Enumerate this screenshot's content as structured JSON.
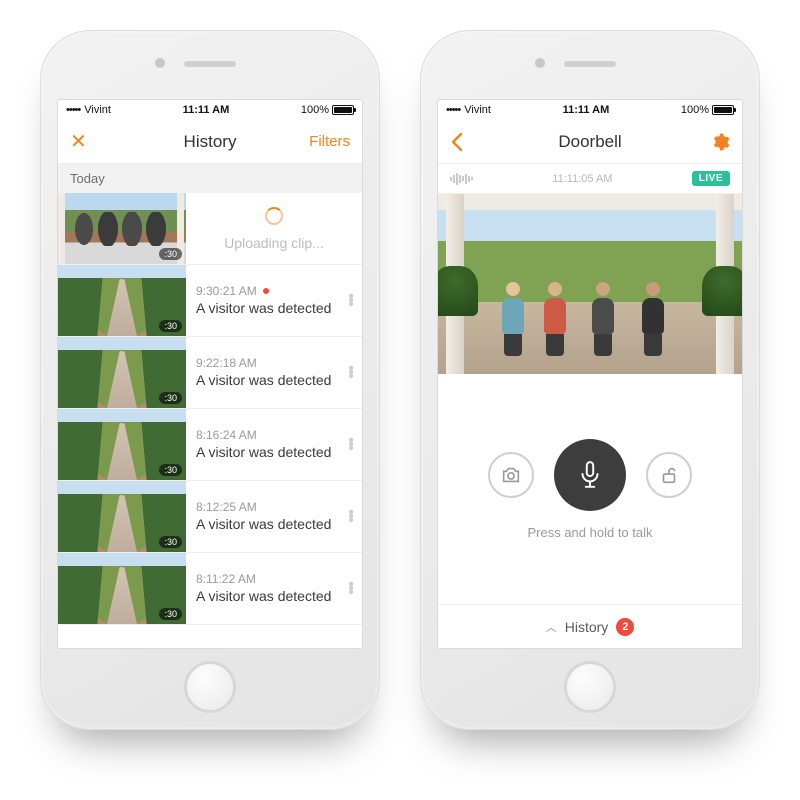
{
  "status": {
    "dots": "•••••",
    "carrier": "Vivint",
    "time": "11:11 AM",
    "battery": "100%"
  },
  "accent": "#f58220",
  "left": {
    "title": "History",
    "filters": "Filters",
    "section": "Today",
    "uploading": "Uploading clip...",
    "clip_duration": ":30",
    "clips": [
      {
        "time": "9:30:21 AM",
        "title": "A visitor was detected",
        "recording": true
      },
      {
        "time": "9:22:18 AM",
        "title": "A visitor was detected",
        "recording": false
      },
      {
        "time": "8:16:24 AM",
        "title": "A visitor was detected",
        "recording": false
      },
      {
        "time": "8:12:25 AM",
        "title": "A visitor was detected",
        "recording": false
      },
      {
        "time": "8:11:22 AM",
        "title": "A visitor was detected",
        "recording": false
      }
    ]
  },
  "right": {
    "title": "Doorbell",
    "timestamp": "11:11:05 AM",
    "live": "LIVE",
    "hint": "Press and hold to talk",
    "history_label": "History",
    "history_count": "2"
  }
}
